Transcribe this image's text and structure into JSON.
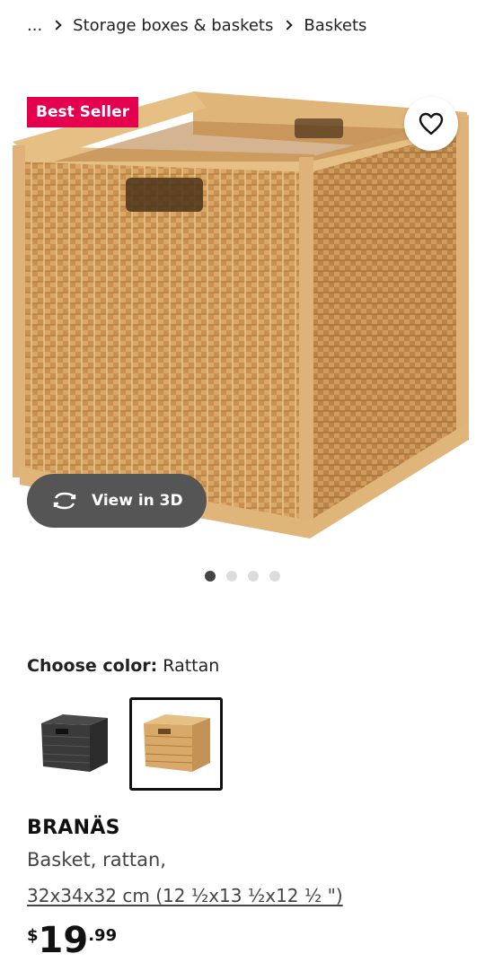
{
  "breadcrumb": {
    "ellipsis": "...",
    "items": [
      "Storage boxes & baskets",
      "Baskets"
    ]
  },
  "hero": {
    "badge": "Best Seller",
    "view3d_label": "View in 3D",
    "icons": {
      "favorite": "heart-icon",
      "view3d": "rotate-3d-icon"
    },
    "carousel": {
      "count": 4,
      "active": 1
    }
  },
  "color": {
    "label": "Choose color:",
    "selected": "Rattan",
    "options": [
      {
        "name": "dark gray",
        "color": "#3a3a3a"
      },
      {
        "name": "rattan",
        "color": "#d9a96a",
        "selected": true
      }
    ]
  },
  "product": {
    "name": "BRANÄS",
    "description": "Basket, rattan,",
    "size": "32x34x32 cm (12 ½x13 ½x12 ½ \")",
    "price": {
      "currency": "$",
      "integer": "19",
      "decimal": ".99"
    }
  },
  "colors": {
    "badge_bg": "#e4004f",
    "view3d_bg": "#555555"
  }
}
